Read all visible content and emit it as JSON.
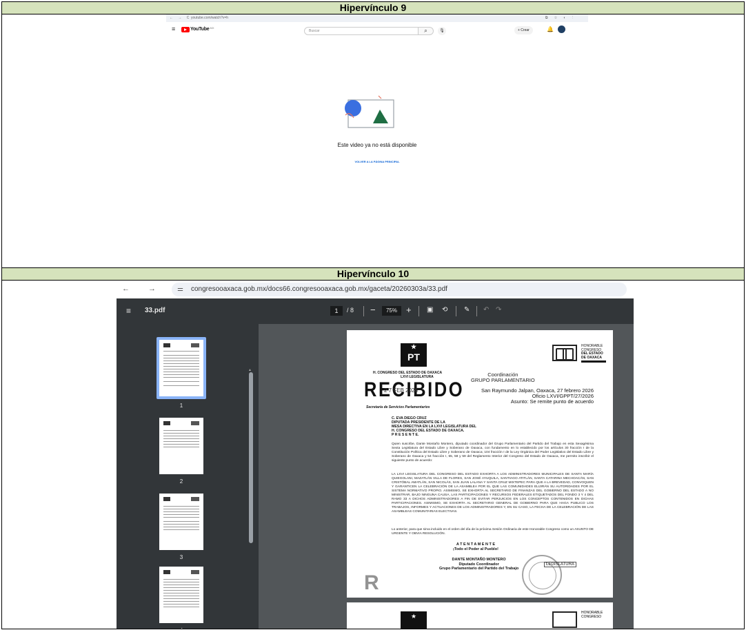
{
  "sections": [
    {
      "title": "Hipervínculo 9"
    },
    {
      "title": "Hipervínculo 10"
    }
  ],
  "youtube": {
    "browser_url": "youtube.com/watch?v=h",
    "logo_text": "YouTube",
    "logo_region": "MX",
    "search_placeholder": "Buscar",
    "create_label": "+ Crear",
    "unavailable_message": "Este video ya no está disponible",
    "home_link": "VOLVER A LA PÁGINA PRINCIPAL",
    "brand_color": "#ff0000"
  },
  "pdf_viewer": {
    "browser_url": "congresooaxaca.gob.mx/docs66.congresooaxaca.gob.mx/gaceta/20260303a/33.pdf",
    "file_name": "33.pdf",
    "current_page": "1",
    "total_pages": "/ 8",
    "zoom": "75%",
    "thumbnails": [
      "1",
      "2",
      "3",
      "4"
    ]
  },
  "document": {
    "party_logo": "PT",
    "congress_logo_lines": [
      "HONORABLE",
      "CONGRESO",
      "DEL ESTADO",
      "DE OAXACA"
    ],
    "sender_left_lines": [
      "H. CONGRESO DEL ESTADO DE OAXACA",
      "LXVI LEGISLATURA"
    ],
    "coordination_lines": [
      "Coordinación",
      "GRUPO PARLAMENTARIO"
    ],
    "stamp_word": "RECIBIDO",
    "stamp_date": "2 7 FEB 2026",
    "secretariat": "Secretaría de Servicios Parlamentarios",
    "place_date": "San Raymundo Jalpan, Oaxaca, 27 febrero 2026",
    "office": "Oficio LXVI/GPPT/27/2026",
    "subject": "Asunto: Se remite punto de acuerdo",
    "addressee": [
      "C. EVA DIEGO CRUZ",
      "DIPUTADA PRESIDENTE DE LA",
      "MESA DIRECTIVA EN LA LXVI LEGISLATURA DEL",
      "H. CONGRESO DEL ESTADO DE OAXACA.",
      "P R E S E N T E."
    ],
    "paragraph_1": "Quien suscribe, Dante Montaño Montero, diputado coordinador del Grupo Parlamentario del Partido del Trabajo en esta Sexagésima Sexta Legislatura del Estado Libre y Soberano de Oaxaca, con fundamento en lo establecido por los artículos 30 fracción I de la Constitución Política del Estado Libre y Soberano de Oaxaca; 104 fracción I de la Ley Orgánica del Poder Legislativo del Estado Libre y Soberano de Oaxaca y 54 fracción I, 55, 58 y 59 del Reglamento Interior del Congreso del Estado de Oaxaca, me permito inscribir el siguiente punto de acuerdo:",
    "paragraph_2": "LA LXVI LEGISLATURA DEL CONGRESO DEL ESTADO EXHORTA A LOS ADMINISTRADORES MUNICIPALES DE SANTA MARÍA QUIEGOLANI, MAZATLÁN VILLA DE FLORES, SAN JOSÉ AYUQUILA, SANTIAGO ATITLÁN, SANTA CATARINA MECHOACÁN, SAN CRISTÓBAL AMATLÁN, SAN NICOLÁS, SAN JUAN LALANA Y SANTA CRUZ MIXTEPEC PARA QUE A LA BREVEDAD, CONVOQUEN Y GARANTICEN LA CELEBRACIÓN DE LA ASAMBLEA POR EL QUE LAS COMUNIDADES ELIJIRÁN SU AUTORIDADES POR EL SISTEMA NORMATIVO PROPIO. ASIMISMO, SE EXHORTA AL SECRETARIO DE FINANZAS DEL GOBIERNO DEL ESTADO A NO MINISTRAR, BAJO NINGUNA CAUSA, LAS PARTICIPACIONES Y RECURSOS FEDERALES ETIQUETADOS DEL FONDO 3 Y 4 DEL RAMO 33 A DICHOS ADMINISTRADORES A FIN DE EVITAR PERJUICIOS EN LOS CONCEPTOS CONTENIDOS EN DICHAS PARTICIPACIONES. ASIMISMO, SE EXHORTA AL SECRETARIO GENERAL DE GOBIERNO PARA QUE HAGA PUBLICO LOS TRABAJOS, INFORMES Y ACTUACIONES DE LOS ADMINISTRADORES Y, EN SU CASO, LA FECHA DE LA CELEBRACIÓN DE LAS ASAMBLEAS COMUNITARIAS ELECTIVAS.",
    "paragraph_3": "Lo anterior, para que sirva incluido en el orden del día de la próxima Sesión Ordinaria de este Honorable Congreso como un ASUNTO DE URGENTE Y OBVIA RESOLUCIÓN.",
    "closing": [
      "A T E N T A M E N T E",
      "¡Todo el Poder al Pueblo!"
    ],
    "signer": [
      "DANTE MONTAÑO MONTERO",
      "Diputado Coordinador",
      "Grupo Parlamentario del Partido del Trabajo"
    ],
    "legislatura_stamp": "LEGISLATURA"
  }
}
